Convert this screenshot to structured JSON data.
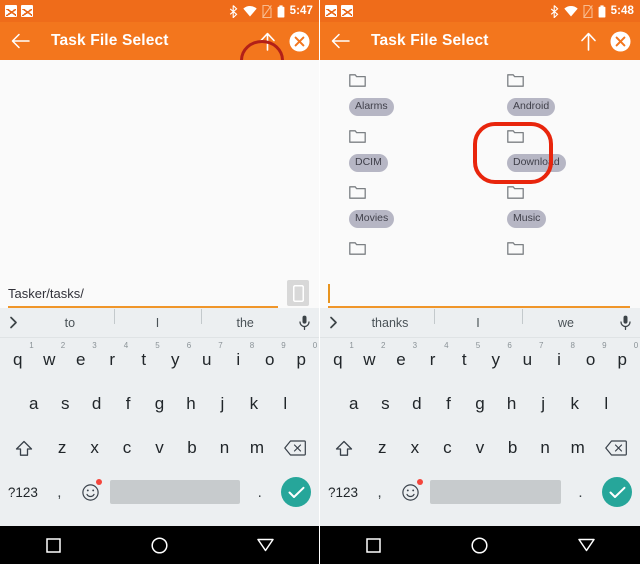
{
  "panels": [
    {
      "id": "left",
      "status": {
        "time": "5:47",
        "icons": [
          "image-notification-icon",
          "chart-notification-icon",
          "bluetooth-icon",
          "wifi-icon",
          "no-sim-icon",
          "battery-icon"
        ]
      },
      "appbar": {
        "back_icon": "back-arrow-icon",
        "title": "Task File Select",
        "up_icon": "up-arrow-icon",
        "close_icon": "close-icon"
      },
      "folders": [],
      "field": {
        "value": "Tasker/tasks/",
        "placeholder": "",
        "show_caret": false,
        "keyboard_toggle_icon": "keyboard-toggle-icon"
      },
      "suggestions": [
        "to",
        "I",
        "the"
      ],
      "annotation": {
        "type": "ellipse",
        "target": "up-arrow-icon",
        "color": "#b22018"
      }
    },
    {
      "id": "right",
      "status": {
        "time": "5:48",
        "icons": [
          "image-notification-icon",
          "chart-notification-icon",
          "bluetooth-icon",
          "wifi-icon",
          "no-sim-icon",
          "battery-icon"
        ]
      },
      "appbar": {
        "back_icon": "back-arrow-icon",
        "title": "Task File Select",
        "up_icon": "up-arrow-icon",
        "close_icon": "close-icon"
      },
      "folders": [
        [
          "Alarms",
          "Android"
        ],
        [
          "DCIM",
          "Download"
        ],
        [
          "Movies",
          "Music"
        ],
        [
          "",
          ""
        ]
      ],
      "field": {
        "value": "",
        "placeholder": "",
        "show_caret": true,
        "keyboard_toggle_icon": ""
      },
      "suggestions": [
        "thanks",
        "I",
        "we"
      ],
      "annotation": {
        "type": "rounded-rect",
        "target": "Download",
        "color": "#e8250c"
      }
    }
  ],
  "keyboard": {
    "row1": [
      {
        "key": "q",
        "num": "1"
      },
      {
        "key": "w",
        "num": "2"
      },
      {
        "key": "e",
        "num": "3"
      },
      {
        "key": "r",
        "num": "4"
      },
      {
        "key": "t",
        "num": "5"
      },
      {
        "key": "y",
        "num": "6"
      },
      {
        "key": "u",
        "num": "7"
      },
      {
        "key": "i",
        "num": "8"
      },
      {
        "key": "o",
        "num": "9"
      },
      {
        "key": "p",
        "num": "0"
      }
    ],
    "row2": [
      "a",
      "s",
      "d",
      "f",
      "g",
      "h",
      "j",
      "k",
      "l"
    ],
    "row3": [
      "z",
      "x",
      "c",
      "v",
      "b",
      "n",
      "m"
    ],
    "shift_icon": "shift-icon",
    "backspace_icon": "backspace-icon",
    "symbols_label": "?123",
    "comma_label": ",",
    "period_label": ".",
    "emoji_icon": "emoji-icon",
    "space_label": "",
    "enter_icon": "check-icon",
    "chevron_icon": "chevron-right-icon",
    "mic_icon": "microphone-icon"
  },
  "navbar": {
    "recents_icon": "square-recents-icon",
    "home_icon": "circle-home-icon",
    "back_icon": "triangle-back-icon"
  },
  "colors": {
    "status_bar": "#ef6c1a",
    "app_bar": "#f3761d",
    "accent_underline": "#f0962a",
    "folder_chip": "#b6b6c4",
    "enter_key": "#26a69a",
    "annotation_left": "#b22018",
    "annotation_right": "#e8250c"
  }
}
